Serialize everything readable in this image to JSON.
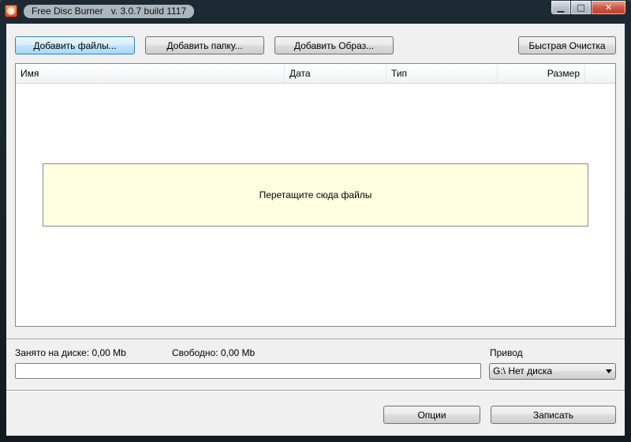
{
  "window": {
    "app_name": "Free Disc Burner",
    "version": "v. 3.0.7 build 1117",
    "controls": {
      "minimize": "▁",
      "maximize": "□",
      "close": "✕"
    }
  },
  "toolbar": {
    "add_files": "Добавить файлы...",
    "add_folder": "Добавить папку...",
    "add_image": "Добавить Образ...",
    "quick_erase": "Быстрая Очистка"
  },
  "file_list": {
    "columns": [
      "Имя",
      "Дата",
      "Тип",
      "Размер"
    ],
    "rows": [],
    "drop_hint": "Перетащите сюда файлы"
  },
  "status": {
    "used_label": "Занято на диске: 0,00 Mb",
    "free_label": "Свободно: 0,00 Mb",
    "progress_fraction": 0
  },
  "drive": {
    "label": "Привод",
    "selected": "G:\\ Нет диска"
  },
  "footer": {
    "options": "Опции",
    "burn": "Записать"
  }
}
